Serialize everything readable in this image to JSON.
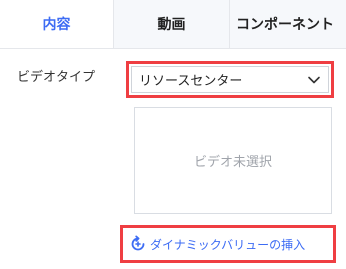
{
  "tabs": [
    {
      "label": "内容",
      "active": true
    },
    {
      "label": "動画",
      "active": false
    },
    {
      "label": "コンポーネント",
      "active": false
    }
  ],
  "video_type": {
    "label": "ビデオタイプ",
    "selected": "リソースセンター",
    "icon": "chevron-down-icon"
  },
  "video_placeholder": {
    "text": "ビデオ未選択"
  },
  "dynamic_value": {
    "label": "ダイナミックバリューの挿入",
    "icon": "refresh-icon"
  },
  "colors": {
    "accent": "#3d6cf4",
    "highlight": "#ef3e42"
  }
}
